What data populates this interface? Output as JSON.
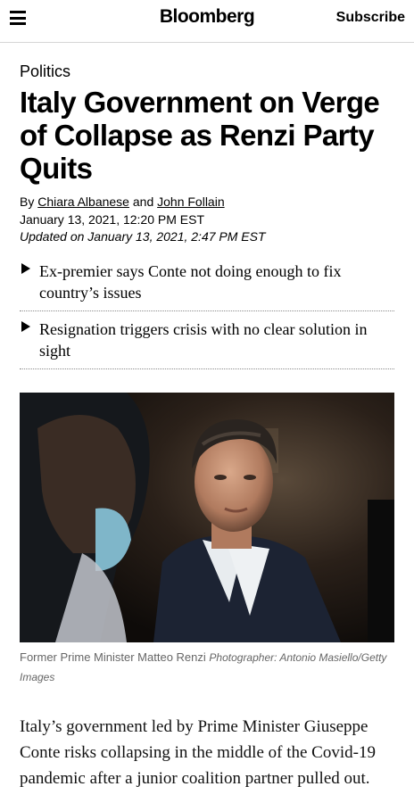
{
  "header": {
    "logo": "Bloomberg",
    "subscribe_label": "Subscribe",
    "menu_icon": "hamburger-menu-icon"
  },
  "article": {
    "kicker": "Politics",
    "headline": "Italy Government on Verge of Collapse as Renzi Party Quits",
    "byline": {
      "prefix": "By",
      "author1": "Chiara Albanese",
      "conjunction": "and",
      "author2": "John Follain"
    },
    "published": "January 13, 2021, 12:20 PM EST",
    "updated_prefix": "Updated on",
    "updated": "January 13, 2021, 2:47 PM EST",
    "abstract": [
      "Ex-premier says Conte not doing enough to fix country’s issues",
      "Resignation triggers crisis with no clear solution in sight"
    ],
    "photo": {
      "caption": "Former Prime Minister Matteo Renzi",
      "credit": "Photographer: Antonio Masiello/Getty Images"
    },
    "body": "Italy’s government led by Prime Minister Giuseppe Conte risks collapsing in the middle of the Covid-19 pandemic after a junior coalition partner pulled out."
  }
}
